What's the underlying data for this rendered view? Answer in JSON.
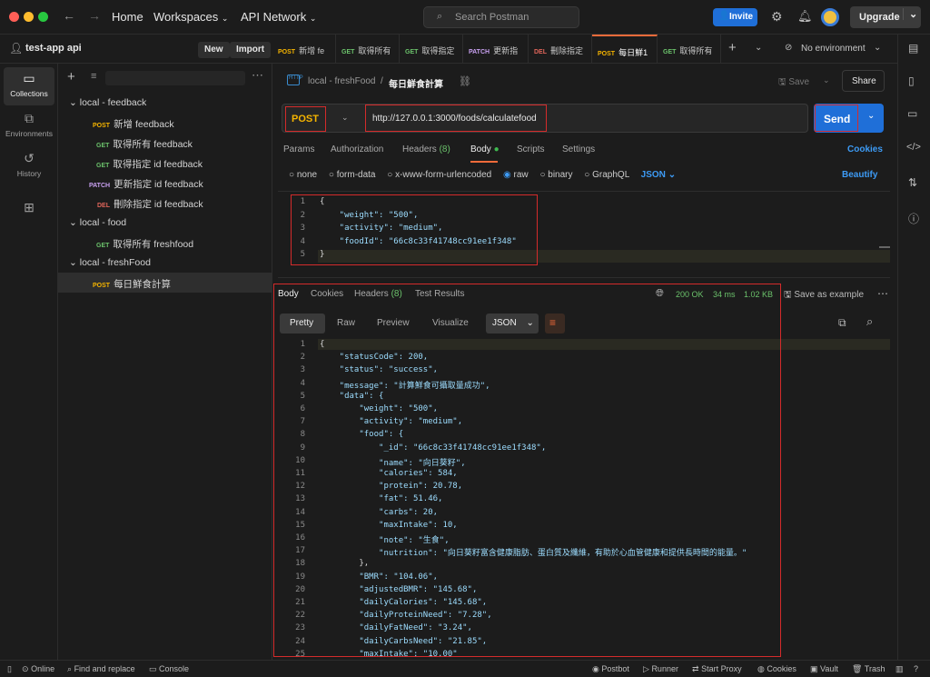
{
  "topbar": {
    "home": "Home",
    "workspaces": "Workspaces",
    "api_network": "API Network",
    "search_placeholder": "Search Postman",
    "invite": "Invite",
    "upgrade": "Upgrade"
  },
  "workspace": {
    "name": "test-app api",
    "new_label": "New",
    "import_label": "Import"
  },
  "rail": [
    {
      "label": "Collections",
      "icon": "collections-icon"
    },
    {
      "label": "Environments",
      "icon": "environments-icon"
    },
    {
      "label": "History",
      "icon": "history-icon"
    }
  ],
  "tree": [
    {
      "type": "folder",
      "label": "local - feedback"
    },
    {
      "type": "req",
      "method": "POST",
      "label": "新增 feedback"
    },
    {
      "type": "req",
      "method": "GET",
      "label": "取得所有 feedback"
    },
    {
      "type": "req",
      "method": "GET",
      "label": "取得指定 id feedback"
    },
    {
      "type": "req",
      "method": "PATCH",
      "label": "更新指定 id feedback"
    },
    {
      "type": "req",
      "method": "DEL",
      "label": "刪除指定 id feedback"
    },
    {
      "type": "folder",
      "label": "local - food"
    },
    {
      "type": "req",
      "method": "GET",
      "label": "取得所有 freshfood"
    },
    {
      "type": "folder",
      "label": "local - freshFood"
    },
    {
      "type": "req",
      "method": "POST",
      "label": "每日鮮食計算"
    }
  ],
  "tabs": [
    {
      "method": "POST",
      "label": "新增 fe"
    },
    {
      "method": "GET",
      "label": "取得所有"
    },
    {
      "method": "GET",
      "label": "取得指定"
    },
    {
      "method": "PATCH",
      "label": "更新指"
    },
    {
      "method": "DEL",
      "label": "刪除指定"
    },
    {
      "method": "POST",
      "label": "每日鮮1"
    },
    {
      "method": "GET",
      "label": "取得所有"
    }
  ],
  "env": "No environment",
  "request": {
    "breadcrumb_parent": "local - freshFood",
    "breadcrumb_sep": "/",
    "title": "每日鮮食計算",
    "save": "Save",
    "share": "Share",
    "method": "POST",
    "url": "http://127.0.0.1:3000/foods/calculatefood",
    "send": "Send"
  },
  "req_tabs": {
    "params": "Params",
    "auth": "Authorization",
    "headers": "Headers",
    "headers_count": "(8)",
    "body": "Body",
    "scripts": "Scripts",
    "settings": "Settings",
    "cookies": "Cookies"
  },
  "body_types": {
    "none": "none",
    "form_data": "form-data",
    "urlencoded": "x-www-form-urlencoded",
    "raw": "raw",
    "binary": "binary",
    "graphql": "GraphQL",
    "json": "JSON",
    "beautify": "Beautify"
  },
  "req_body": [
    "{",
    "    \"weight\": \"500\",",
    "    \"activity\": \"medium\",",
    "    \"foodId\": \"66c8c33f41748cc91ee1f348\"",
    "}"
  ],
  "resp_tabs": {
    "body": "Body",
    "cookies": "Cookies",
    "headers": "Headers",
    "headers_count": "(8)",
    "tests": "Test Results",
    "status": "200 OK",
    "time": "34 ms",
    "size": "1.02 KB",
    "save_example": "Save as example"
  },
  "resp_view": {
    "pretty": "Pretty",
    "raw": "Raw",
    "preview": "Preview",
    "visualize": "Visualize",
    "format": "JSON"
  },
  "resp_body": [
    "{",
    "    \"statusCode\": 200,",
    "    \"status\": \"success\",",
    "    \"message\": \"計算鮮食可攝取量成功\",",
    "    \"data\": {",
    "        \"weight\": \"500\",",
    "        \"activity\": \"medium\",",
    "        \"food\": {",
    "            \"_id\": \"66c8c33f41748cc91ee1f348\",",
    "            \"name\": \"向日葵籽\",",
    "            \"calories\": 584,",
    "            \"protein\": 20.78,",
    "            \"fat\": 51.46,",
    "            \"carbs\": 20,",
    "            \"maxIntake\": 10,",
    "            \"note\": \"生食\",",
    "            \"nutrition\": \"向日葵籽富含健康脂肪、蛋白質及纖維，有助於心血管健康和提供長時間的能量。\"",
    "        },",
    "        \"BMR\": \"104.06\",",
    "        \"adjustedBMR\": \"145.68\",",
    "        \"dailyCalories\": \"145.68\",",
    "        \"dailyProteinNeed\": \"7.28\",",
    "        \"dailyFatNeed\": \"3.24\",",
    "        \"dailyCarbsNeed\": \"21.85\",",
    "        \"maxIntake\": \"10.00\""
  ],
  "statusbar": {
    "online": "Online",
    "find": "Find and replace",
    "console": "Console",
    "postbot": "Postbot",
    "runner": "Runner",
    "proxy": "Start Proxy",
    "cookies": "Cookies",
    "vault": "Vault",
    "trash": "Trash"
  }
}
